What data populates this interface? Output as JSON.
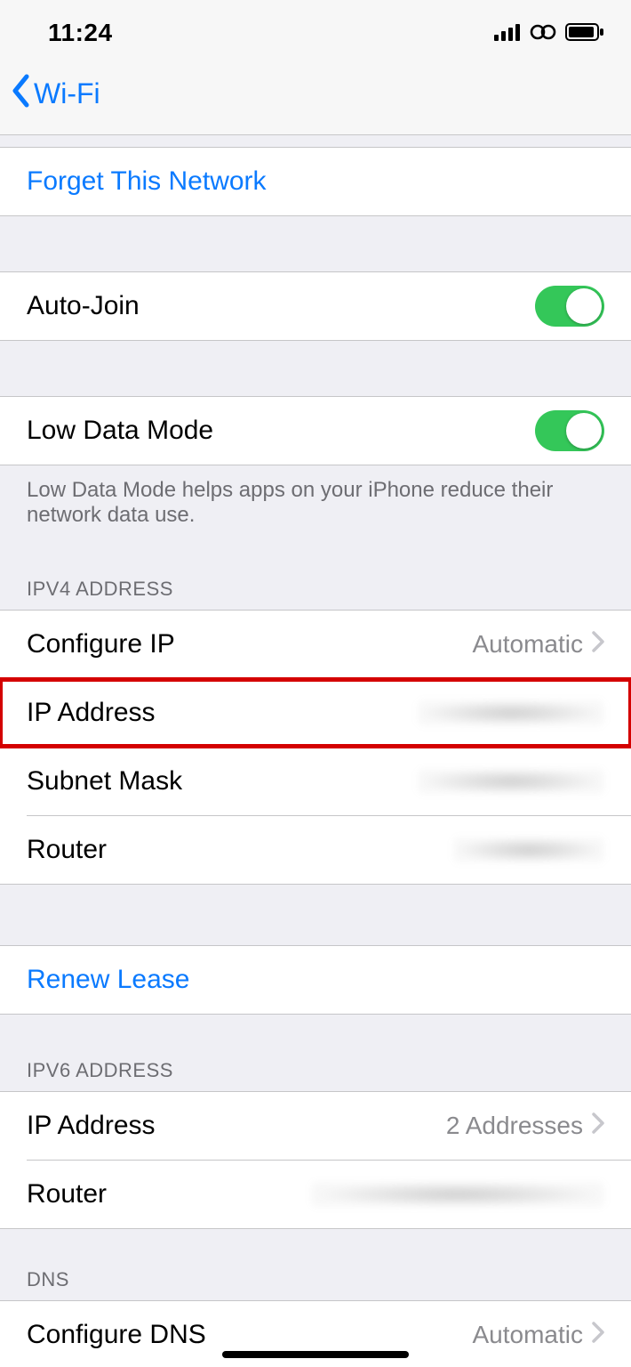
{
  "status": {
    "time": "11:24"
  },
  "nav": {
    "back_label": "Wi-Fi"
  },
  "forget": {
    "label": "Forget This Network"
  },
  "auto_join": {
    "label": "Auto-Join",
    "on": true
  },
  "low_data": {
    "label": "Low Data Mode",
    "on": true,
    "footer": "Low Data Mode helps apps on your iPhone reduce their network data use."
  },
  "ipv4": {
    "header": "IPV4 ADDRESS",
    "configure_label": "Configure IP",
    "configure_value": "Automatic",
    "ip_label": "IP Address",
    "subnet_label": "Subnet Mask",
    "router_label": "Router"
  },
  "renew": {
    "label": "Renew Lease"
  },
  "ipv6": {
    "header": "IPV6 ADDRESS",
    "ip_label": "IP Address",
    "ip_value": "2 Addresses",
    "router_label": "Router"
  },
  "dns": {
    "header": "DNS",
    "configure_label": "Configure DNS",
    "configure_value": "Automatic"
  }
}
